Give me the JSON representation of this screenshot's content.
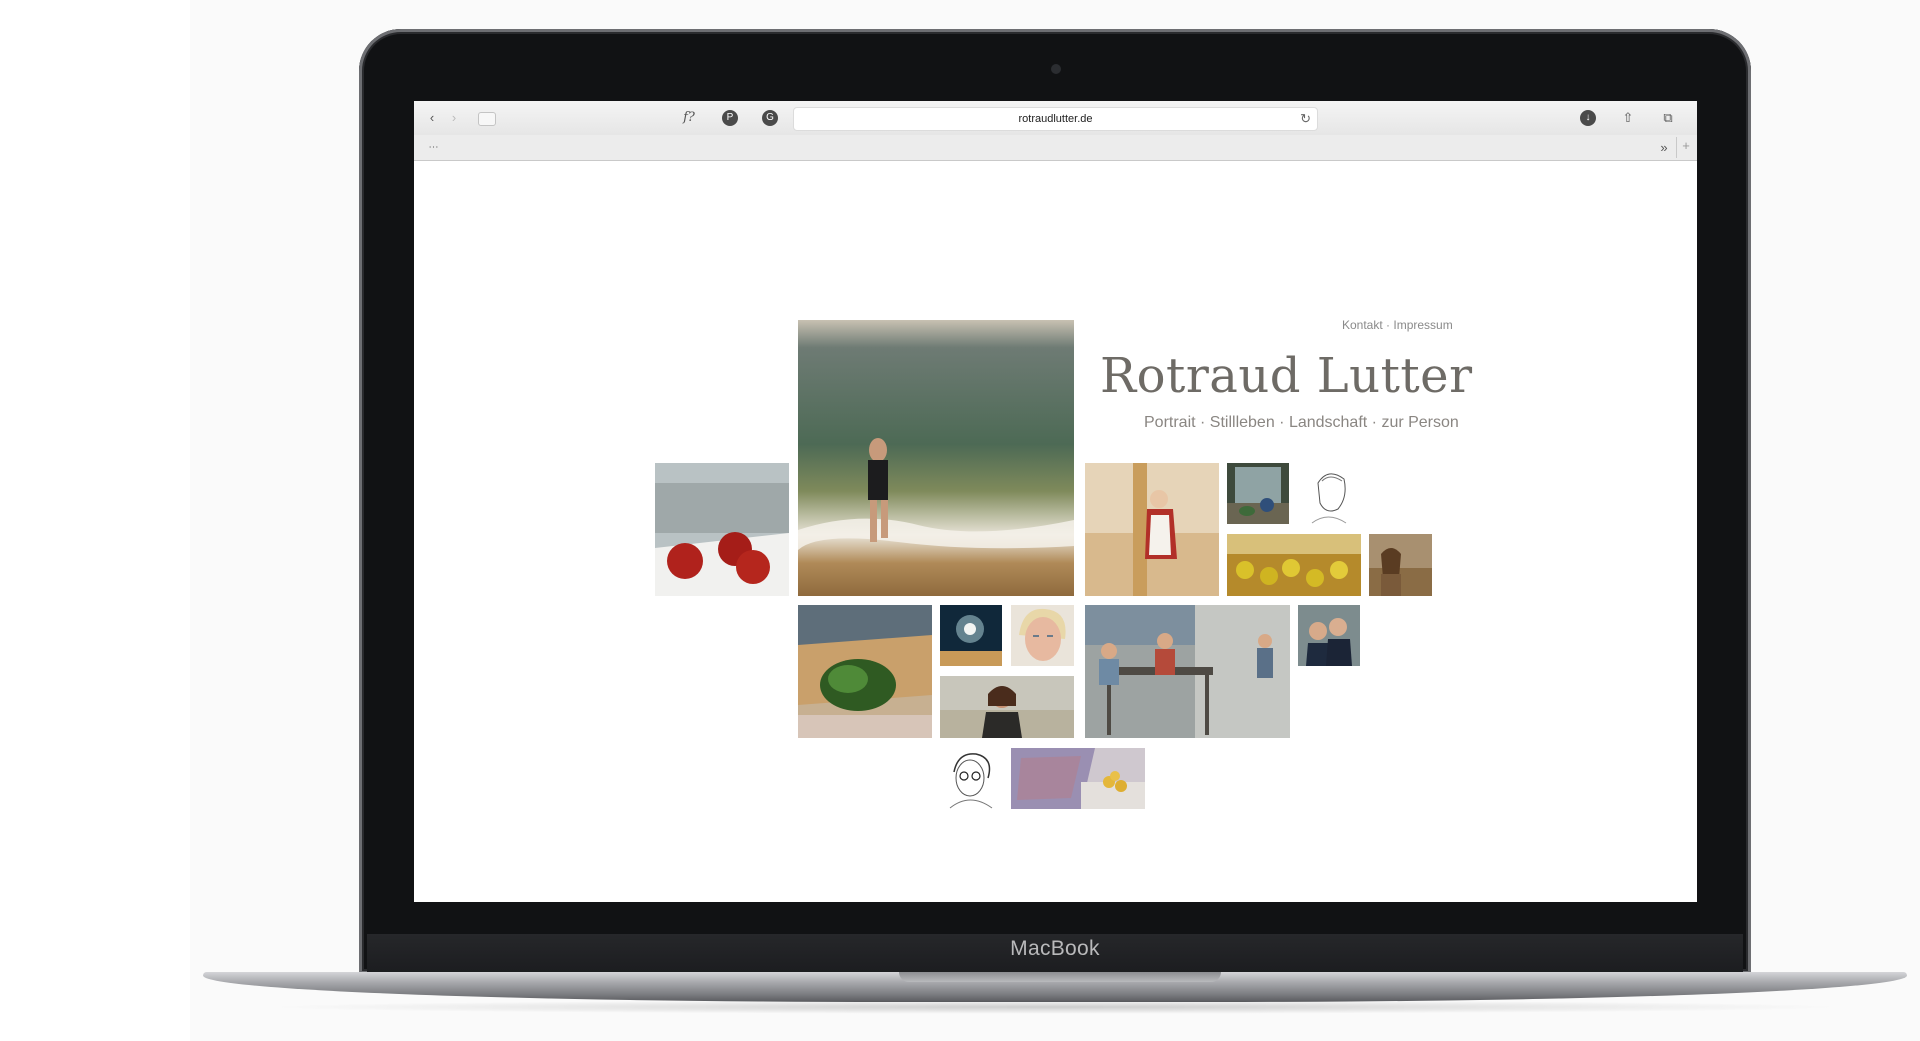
{
  "device": {
    "label": "MacBook"
  },
  "browser": {
    "url": "rotraudlutter.de",
    "icons": [
      "back-icon",
      "forward-icon",
      "sidebar-icon",
      "font-icon",
      "pinterest-icon",
      "extension-icon",
      "reload-icon",
      "download-icon",
      "share-icon",
      "tabs-icon",
      "favorites-grid-icon",
      "overflow-icon",
      "new-tab-icon"
    ]
  },
  "page": {
    "top_links": "Kontakt · Impressum",
    "title": "Rotraud Lutter",
    "nav": "Portrait · Stillleben · Landschaft · zur Person"
  }
}
